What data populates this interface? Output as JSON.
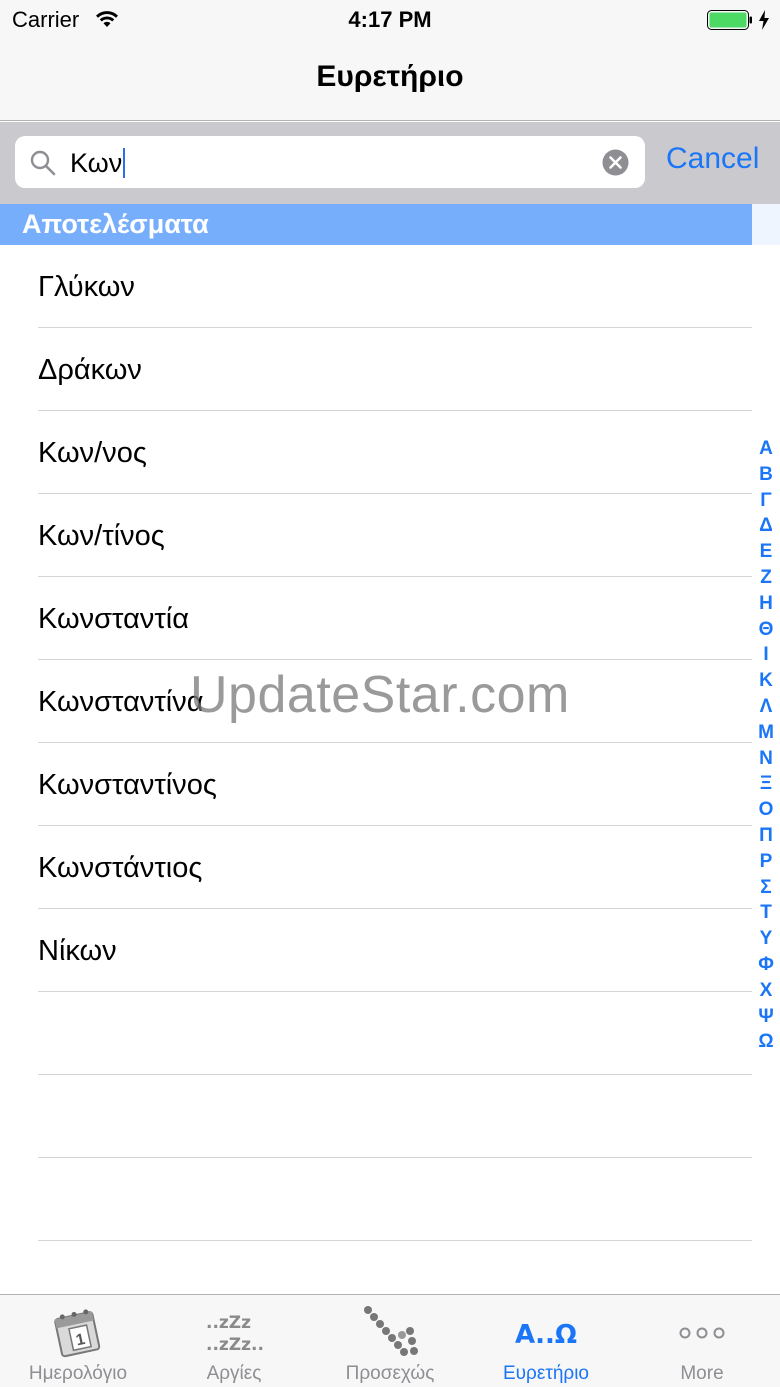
{
  "status_bar": {
    "carrier": "Carrier",
    "time": "4:17 PM"
  },
  "nav": {
    "title": "Ευρετήριο"
  },
  "search": {
    "query": "Κων",
    "cancel_label": "Cancel"
  },
  "section": {
    "title": "Αποτελέσματα"
  },
  "results": [
    "Γλύκων",
    "Δράκων",
    "Κων/νος",
    "Κων/τίνος",
    "Κωνσταντία",
    "Κωνσταντίνα",
    "Κωνσταντίνος",
    "Κωνστάντιος",
    "Νίκων",
    "",
    "",
    ""
  ],
  "index_letters": [
    "Α",
    "Β",
    "Γ",
    "Δ",
    "Ε",
    "Ζ",
    "Η",
    "Θ",
    "Ι",
    "Κ",
    "Λ",
    "Μ",
    "Ν",
    "Ξ",
    "Ο",
    "Π",
    "Ρ",
    "Σ",
    "Τ",
    "Υ",
    "Φ",
    "Χ",
    "Ψ",
    "Ω"
  ],
  "watermark": "UpdateStar.com",
  "tabs": [
    {
      "label": "Ημερολόγιο",
      "icon": "calendar-icon",
      "active": false
    },
    {
      "label": "Αργίες",
      "icon": "sleep-zzz-icon",
      "active": false
    },
    {
      "label": "Προσεχώς",
      "icon": "upcoming-dots-icon",
      "active": false
    },
    {
      "label": "Ευρετήριο",
      "icon": "alpha-omega-icon",
      "icon_text": "Α..Ω",
      "active": true
    },
    {
      "label": "More",
      "icon": "more-dots-icon",
      "active": false
    }
  ],
  "colors": {
    "accent": "#1a76f7",
    "section_header": "#77aefc",
    "battery": "#4cd964"
  }
}
